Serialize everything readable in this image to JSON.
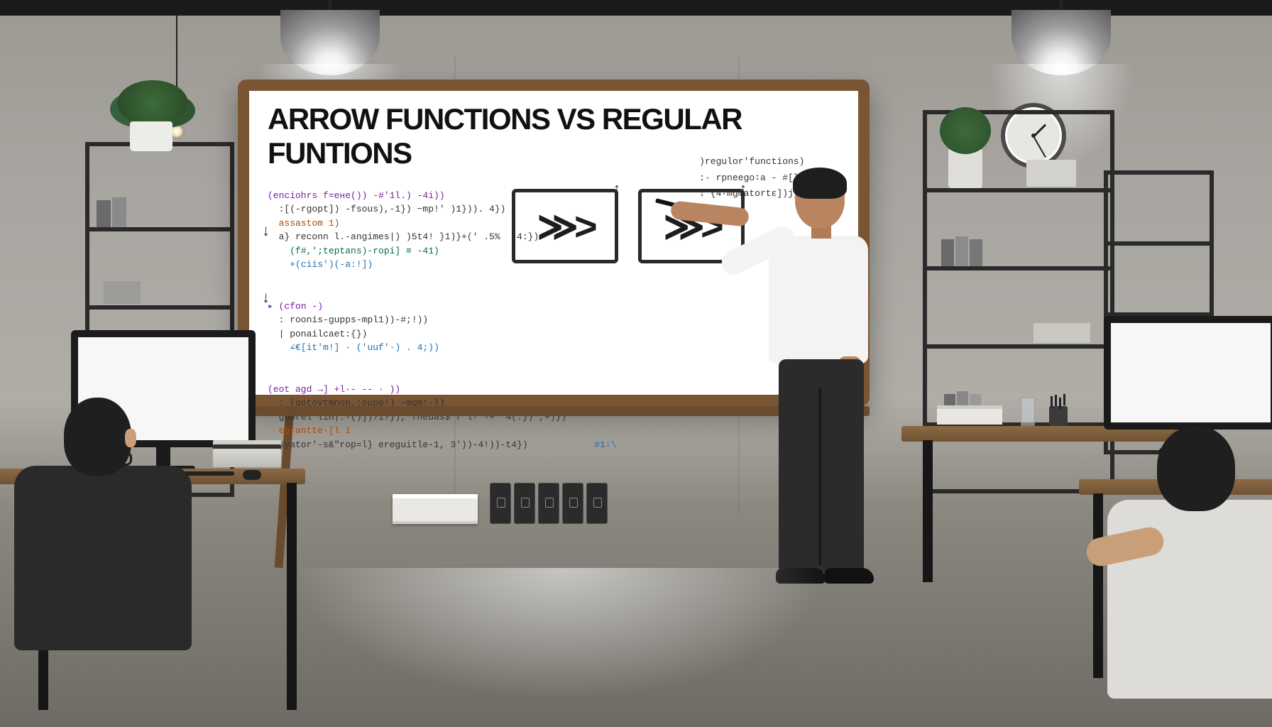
{
  "whiteboard": {
    "title": "ARROW FUNCTIONS VS REGULAR FUNTIONS",
    "code_block1_header": "(enciohrs f=eне()) -#'1l.) -4i))",
    "code_block1_l1": "  :[(-rgopt]) -fsous),-1}) −mp!' )1})). 4})",
    "code_block1_l2": "  assastom 1)",
    "code_block1_l3": "  a} reconn l.-angimes|) )5t4! }1)}+(' .5%  -4:})",
    "code_block1_l4": "    (f#,';teptans)-ropi] ≡ -41)",
    "code_block1_l5": "    +(ciis')(-a:!])",
    "code_block2_header": "▸ (cfon -)",
    "code_block2_l1": "  : roonis-gupps-mpl1))-#;!))",
    "code_block2_l2": "  | ponailcaet:{})",
    "code_block2_l3": "    ∠€[it'm!] · (′uuf'·) . 4;))",
    "code_block3_header": "(eot agd →] +l·- -- · ))",
    "code_block3_l1": "  : (gotovtmnon.:oupe!) –mgm!·})",
    "code_block3_l2": "  goorel lin|.-()])?1?}), fneuas$ f'l· -+  4(.})',+)})",
    "code_block3_l3": "  egrantte·[l i",
    "code_block3_l4": "  syator'-s&\"rop=l} ereguitle-1, 3'))-4!))-t4})",
    "code_block3_tail": "#1∶\\",
    "right_label": ")regulor'functions)",
    "right_l1": ":· rpneego∶a - #[}))",
    "right_l2": "↓ {4·mgmatortε])j,+})",
    "right_l3": "))",
    "glyphs_box1": "≫>",
    "glyphs_box2": "≫>"
  }
}
